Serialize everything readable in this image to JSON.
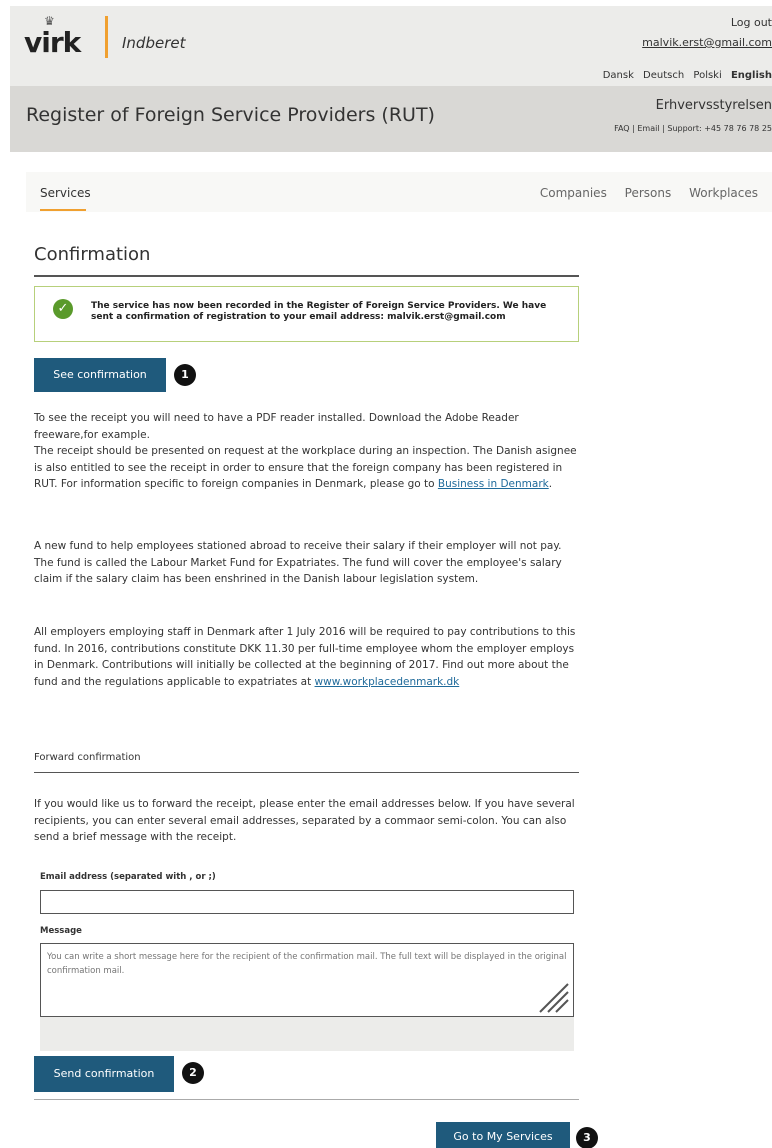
{
  "header": {
    "logo_text": "virk",
    "app_name": "Indberet",
    "logout_label": "Log out",
    "user_email": "malvik.erst@gmail.com",
    "languages": [
      "Dansk",
      "Deutsch",
      "Polski",
      "English"
    ],
    "active_language": "English"
  },
  "titlebar": {
    "site_title": "Register of Foreign Service Providers (RUT)",
    "agency": "Erhvervsstyrelsen",
    "faq": "FAQ",
    "email": "Email",
    "support": "Support: +45 78 76 78 25"
  },
  "nav": {
    "services": "Services",
    "companies": "Companies",
    "persons": "Persons",
    "workplaces": "Workplaces"
  },
  "confirmation": {
    "heading": "Confirmation",
    "notice": "The service has now been recorded in the Register of Foreign Service Providers. We have sent a confirmation of registration to your email address: malvik.erst@gmail.com",
    "see_button": "See confirmation",
    "badge1": "1",
    "p1_line1": "To see the receipt you will need to have a PDF reader installed. Download the Adobe Reader freeware,for example.",
    "p1_line2": "The receipt should be presented on request at the workplace during an inspection. The Danish asignee is also entitled to see the receipt in order to ensure that the foreign company has been registered in RUT. For information specific to foreign companies in Denmark, please go to",
    "p1_link": "Business in Denmark",
    "p2_line1": "A new fund to help employees stationed abroad to receive their salary if their employer will not pay.",
    "p2_line2": "The fund is called the Labour Market Fund for Expatriates. The fund will cover the employee's salary claim if the salary claim has been enshrined in the Danish labour legislation system.",
    "p3": "All employers employing staff in Denmark after 1 July 2016 will be required to pay contributions to this fund. In 2016, contributions constitute DKK 11.30 per full-time employee whom the employer employs in Denmark. Contributions will initially be collected at the beginning of 2017. Find out more about the fund and the regulations applicable to expatriates at",
    "p3_link": "www.workplacedenmark.dk"
  },
  "forward": {
    "heading": "Forward confirmation",
    "intro": "If you would like us to forward the receipt, please enter the email addresses below. If you have several recipients, you can enter several email addresses, separated by a commaor semi-colon. You can also send a brief message with the receipt.",
    "email_label": "Email address (separated with , or ;)",
    "email_value": "",
    "message_label": "Message",
    "message_placeholder": "You can write a short message here for the recipient of the confirmation mail. The full text will be displayed in the original confirmation mail.",
    "send_button": "Send confirmation",
    "badge2": "2"
  },
  "footer": {
    "go_button": "Go to My Services",
    "badge3": "3"
  },
  "colors": {
    "primary_button": "#1f5a7c",
    "accent": "#f0a030",
    "success": "#5a9a2b",
    "notice_border": "#b7d07b"
  }
}
